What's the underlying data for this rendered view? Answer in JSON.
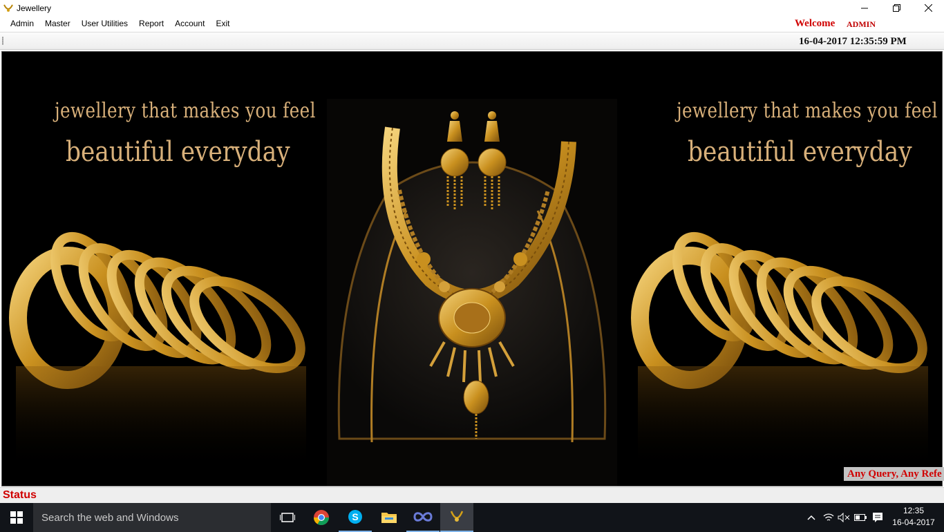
{
  "window": {
    "title": "Jewellery",
    "minimize": "—",
    "restore": "❐",
    "close": "✕"
  },
  "menu": {
    "items": [
      "Admin",
      "Master",
      "User Utilities",
      "Report",
      "Account",
      "Exit"
    ]
  },
  "user": {
    "welcome": "Welcome",
    "name": "ADMIN"
  },
  "toolstrip": {
    "datetime": "16-04-2017 12:35:59 PM"
  },
  "banner": {
    "tagline_line1": "jewellery that makes you feel",
    "tagline_line2": "beautiful everyday",
    "query_text": "Any Query, Any Refe"
  },
  "status": {
    "label": "Status"
  },
  "taskbar": {
    "search_placeholder": "Search the web and Windows",
    "clock_time": "12:35",
    "clock_date": "16-04-2017",
    "apps": [
      "task-view",
      "chrome",
      "skype",
      "file-explorer",
      "infinity-app",
      "jewellery-app"
    ]
  },
  "colors": {
    "accent_red": "#d00000",
    "gold": "#d8b07a",
    "taskbar": "#111419"
  }
}
